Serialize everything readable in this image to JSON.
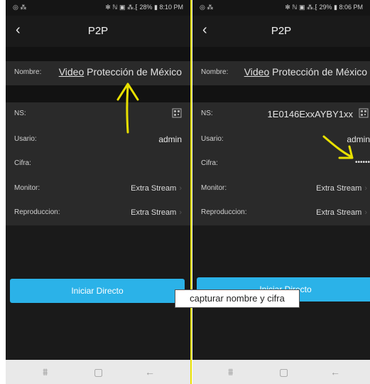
{
  "left_screen": {
    "status_bar": {
      "left": "◎ ⁂",
      "right": "✻ ℕ ▣ ⁂.⁅ 28% ▮ 8:10 PM"
    },
    "title": "P2P",
    "fields": {
      "nombre_label": "Nombre:",
      "nombre_value_word": "Video",
      "nombre_value_rest": " Protección de México",
      "ns_label": "NS:",
      "usario_label": "Usario:",
      "usario_value": "admin",
      "cifra_label": "Cifra:",
      "monitor_label": "Monitor:",
      "monitor_value": "Extra Stream",
      "reproduccion_label": "Reproduccion:",
      "reproduccion_value": "Extra Stream"
    },
    "button_label": "Iniciar Directo"
  },
  "right_screen": {
    "status_bar": {
      "left": "◎ ⁂",
      "right": "✻ ℕ ▣ ⁂.⁅ 29% ▮ 8:06 PM"
    },
    "title": "P2P",
    "fields": {
      "nombre_label": "Nombre:",
      "nombre_value_word": "Video",
      "nombre_value_rest": " Protección de México",
      "ns_label": "NS:",
      "ns_value": "1E0146ExxAYBY1xx",
      "usario_label": "Usario:",
      "usario_value": "admin",
      "cifra_label": "Cifra:",
      "cifra_value": "••••••",
      "monitor_label": "Monitor:",
      "monitor_value": "Extra Stream",
      "reproduccion_label": "Reproduccion:",
      "reproduccion_value": "Extra Stream"
    },
    "button_label": "Iniciar Directo"
  },
  "tooltip": "capturar nombre y cifra",
  "colors": {
    "accent_button": "#2bb2e8",
    "annotation": "#e8e000",
    "row_bg": "#2a2a2a"
  },
  "icons": {
    "back": "chevron-left-icon",
    "scan": "qr-scan-icon",
    "recents": "recents-icon",
    "home": "home-icon",
    "nav_back": "back-arrow-icon"
  }
}
